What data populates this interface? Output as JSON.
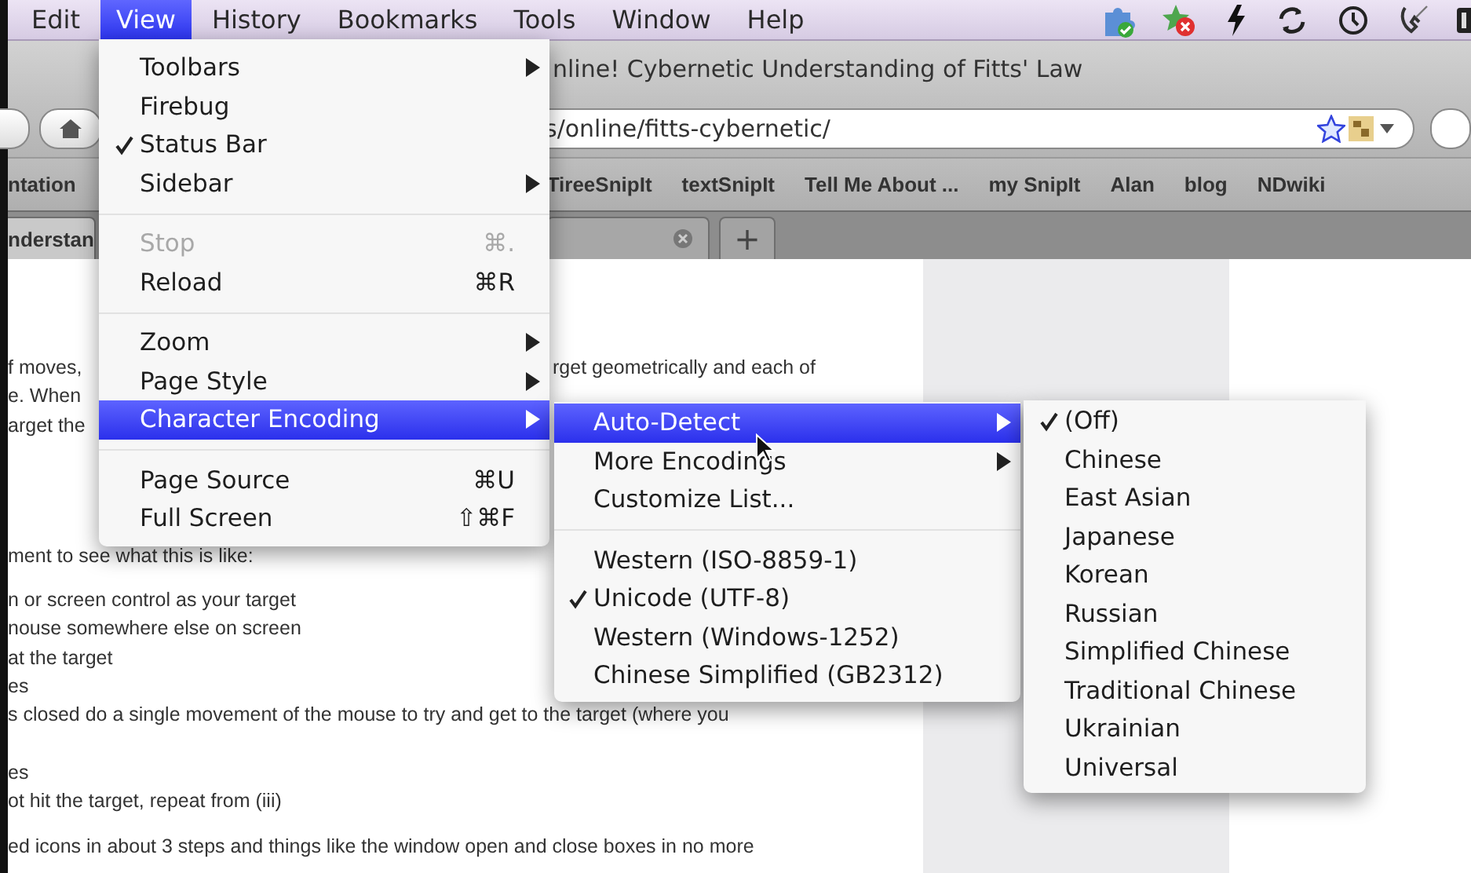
{
  "menu_bar": {
    "items": [
      {
        "label": "Edit",
        "selected": false
      },
      {
        "label": "View",
        "selected": true
      },
      {
        "label": "History",
        "selected": false
      },
      {
        "label": "Bookmarks",
        "selected": false
      },
      {
        "label": "Tools",
        "selected": false
      },
      {
        "label": "Window",
        "selected": false
      },
      {
        "label": "Help",
        "selected": false
      }
    ]
  },
  "browser": {
    "title": "nline! Cybernetic Understanding of Fitts' Law",
    "url": "s/online/fitts-cybernetic/",
    "bookmarks": [
      "ntation",
      "TireeSnipIt",
      "textSnipIt",
      "Tell Me About ...",
      "my SnipIt",
      "Alan",
      "blog",
      "NDwiki"
    ],
    "tabs": [
      {
        "label": "nderstan",
        "selected": true
      },
      {
        "selected": false
      }
    ],
    "new_tab": "+"
  },
  "page_text": {
    "lines": [
      {
        "left": "f moves,",
        "right": "rget geometrically and each of"
      },
      {
        "left": "e. When"
      },
      {
        "left": "arget the"
      },
      {
        "left": "ment to see what this is like:"
      },
      {
        "left": "n or screen control as your target"
      },
      {
        "left": "nouse somewhere else on screen"
      },
      {
        "left": "at the target"
      },
      {
        "left": "es"
      },
      {
        "left": "s closed do a single movement of the mouse to try and get to the target (where you"
      },
      {
        "left": "es"
      },
      {
        "left": "ot hit the target, repeat from (iii)"
      },
      {
        "left": "ed icons in about 3 steps and things like the window open and close boxes in no more"
      }
    ]
  },
  "view_menu": {
    "items": [
      {
        "kind": "item",
        "label": "Toolbars",
        "checked": false,
        "selected": false,
        "disabled": false,
        "submenu": true
      },
      {
        "kind": "item",
        "label": "Firebug",
        "checked": false,
        "selected": false,
        "disabled": false,
        "submenu": false
      },
      {
        "kind": "item",
        "label": "Status Bar",
        "checked": true,
        "selected": false,
        "disabled": false,
        "submenu": false
      },
      {
        "kind": "item",
        "label": "Sidebar",
        "checked": false,
        "selected": false,
        "disabled": false,
        "submenu": true
      },
      {
        "kind": "separator"
      },
      {
        "kind": "item",
        "label": "Stop",
        "shortcut": "⌘.",
        "checked": false,
        "selected": false,
        "disabled": true,
        "submenu": false
      },
      {
        "kind": "item",
        "label": "Reload",
        "shortcut": "⌘R",
        "checked": false,
        "selected": false,
        "disabled": false,
        "submenu": false
      },
      {
        "kind": "separator"
      },
      {
        "kind": "item",
        "label": "Zoom",
        "checked": false,
        "selected": false,
        "disabled": false,
        "submenu": true
      },
      {
        "kind": "item",
        "label": "Page Style",
        "checked": false,
        "selected": false,
        "disabled": false,
        "submenu": true
      },
      {
        "kind": "item",
        "label": "Character Encoding",
        "checked": false,
        "selected": true,
        "disabled": false,
        "submenu": true
      },
      {
        "kind": "separator"
      },
      {
        "kind": "item",
        "label": "Page Source",
        "shortcut": "⌘U",
        "checked": false,
        "selected": false,
        "disabled": false,
        "submenu": false
      },
      {
        "kind": "item",
        "label": "Full Screen",
        "shortcut": "⇧⌘F",
        "checked": false,
        "selected": false,
        "disabled": false,
        "submenu": false
      }
    ]
  },
  "encoding_menu": {
    "items": [
      {
        "kind": "item",
        "label": "Auto-Detect",
        "checked": false,
        "selected": true,
        "disabled": false,
        "submenu": true
      },
      {
        "kind": "item",
        "label": "More Encodings",
        "checked": false,
        "selected": false,
        "disabled": false,
        "submenu": true
      },
      {
        "kind": "item",
        "label": "Customize List...",
        "checked": false,
        "selected": false,
        "disabled": false,
        "submenu": false
      },
      {
        "kind": "separator"
      },
      {
        "kind": "item",
        "label": "Western (ISO-8859-1)",
        "checked": false,
        "selected": false,
        "disabled": false,
        "submenu": false
      },
      {
        "kind": "item",
        "label": "Unicode (UTF-8)",
        "checked": true,
        "selected": false,
        "disabled": false,
        "submenu": false
      },
      {
        "kind": "item",
        "label": "Western (Windows-1252)",
        "checked": false,
        "selected": false,
        "disabled": false,
        "submenu": false
      },
      {
        "kind": "item",
        "label": "Chinese Simplified (GB2312)",
        "checked": false,
        "selected": false,
        "disabled": false,
        "submenu": false
      }
    ]
  },
  "auto_detect_menu": {
    "items": [
      {
        "kind": "item",
        "label": "(Off)",
        "checked": true,
        "selected": false,
        "disabled": false,
        "submenu": false
      },
      {
        "kind": "item",
        "label": "Chinese",
        "checked": false,
        "selected": false,
        "disabled": false,
        "submenu": false
      },
      {
        "kind": "item",
        "label": "East Asian",
        "checked": false,
        "selected": false,
        "disabled": false,
        "submenu": false
      },
      {
        "kind": "item",
        "label": "Japanese",
        "checked": false,
        "selected": false,
        "disabled": false,
        "submenu": false
      },
      {
        "kind": "item",
        "label": "Korean",
        "checked": false,
        "selected": false,
        "disabled": false,
        "submenu": false
      },
      {
        "kind": "item",
        "label": "Russian",
        "checked": false,
        "selected": false,
        "disabled": false,
        "submenu": false
      },
      {
        "kind": "item",
        "label": "Simplified Chinese",
        "checked": false,
        "selected": false,
        "disabled": false,
        "submenu": false
      },
      {
        "kind": "item",
        "label": "Traditional Chinese",
        "checked": false,
        "selected": false,
        "disabled": false,
        "submenu": false
      },
      {
        "kind": "item",
        "label": "Ukrainian",
        "checked": false,
        "selected": false,
        "disabled": false,
        "submenu": false
      },
      {
        "kind": "item",
        "label": "Universal",
        "checked": false,
        "selected": false,
        "disabled": false,
        "submenu": false
      }
    ]
  }
}
